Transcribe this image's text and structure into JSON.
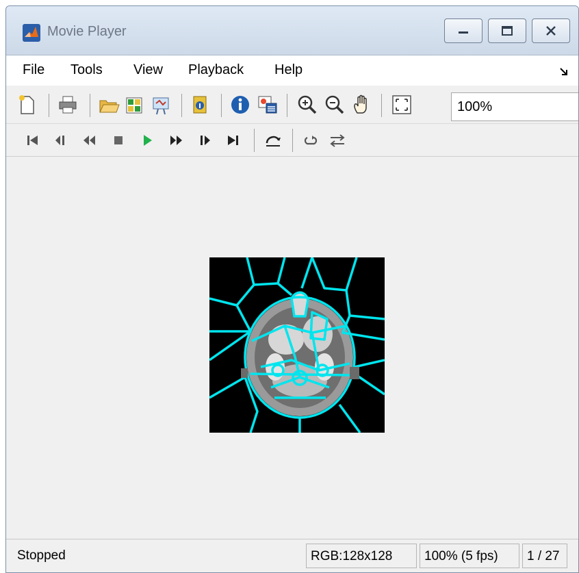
{
  "window": {
    "title": "Movie Player",
    "minimize_icon": "minimize-icon",
    "maximize_icon": "maximize-icon",
    "close_icon": "close-icon"
  },
  "menu": {
    "items": [
      "File",
      "Tools",
      "View",
      "Playback",
      "Help"
    ],
    "dock_icon": "undock-arrow-icon"
  },
  "toolbar": {
    "icons": [
      "new-icon",
      "print-icon",
      "open-icon",
      "export-icon",
      "configure-icon",
      "file-info-icon",
      "info-icon",
      "frame-icon",
      "zoom-in-icon",
      "zoom-out-icon",
      "pan-hand-icon",
      "fit-to-window-icon"
    ],
    "zoom_value": "100%"
  },
  "playback_toolbar": {
    "icons": [
      "go-to-first-icon",
      "step-back-icon",
      "rewind-icon",
      "stop-icon",
      "play-icon",
      "fast-forward-icon",
      "step-forward-icon",
      "go-to-last-icon",
      "jump-to-icon",
      "loop-icon",
      "forward-backward-icon"
    ],
    "play_color": "#22b14c"
  },
  "display": {
    "overlay_color": "#00e5ee",
    "background_color": "#000000"
  },
  "status": {
    "state": "Stopped",
    "image_info": "RGB:128x128",
    "zoom_fps": "100% (5 fps)",
    "frame": "1 / 27"
  }
}
